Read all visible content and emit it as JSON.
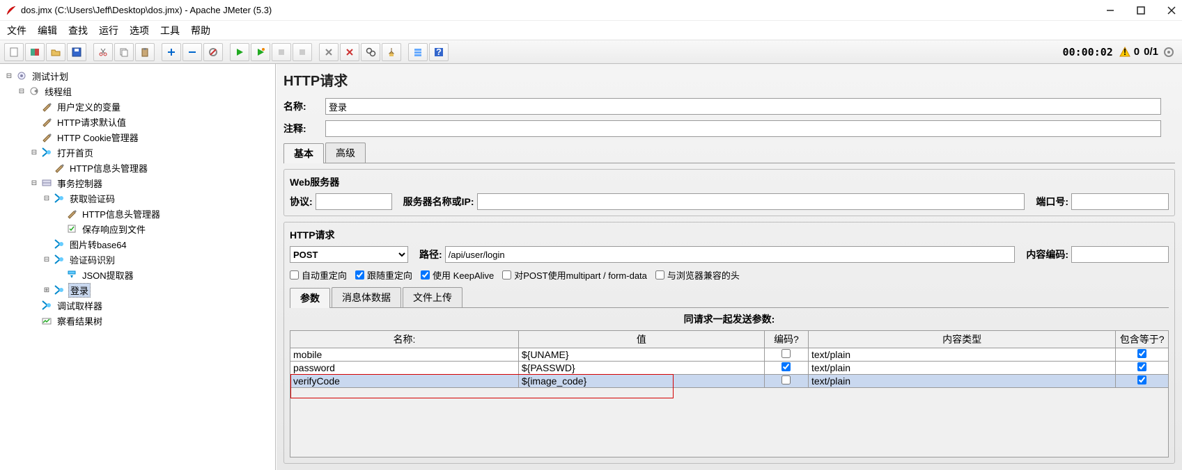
{
  "window": {
    "title": "dos.jmx (C:\\Users\\Jeff\\Desktop\\dos.jmx) - Apache JMeter (5.3)"
  },
  "menus": [
    "文件",
    "编辑",
    "查找",
    "运行",
    "选项",
    "工具",
    "帮助"
  ],
  "status": {
    "elapsed": "00:00:02",
    "warn_count": "0",
    "thread_counts": "0/1"
  },
  "tree": {
    "root": {
      "label": "测试计划"
    },
    "thread_group": {
      "label": "线程组"
    },
    "items": {
      "user_vars": "用户定义的变量",
      "http_defaults": "HTTP请求默认值",
      "cookie_mgr": "HTTP Cookie管理器",
      "open_home": "打开首页",
      "open_home_header": "HTTP信息头管理器",
      "txn_ctrl": "事务控制器",
      "get_captcha": "获取验证码",
      "get_captcha_header": "HTTP信息头管理器",
      "save_resp_file": "保存响应到文件",
      "img_base64": "图片转base64",
      "captcha_ocr": "验证码识别",
      "json_extractor": "JSON提取器",
      "login": "登录",
      "debug_sampler": "调试取样器",
      "view_results": "察看结果树"
    }
  },
  "main": {
    "title": "HTTP请求",
    "name_label": "名称:",
    "name_value": "登录",
    "comment_label": "注释:",
    "comment_value": "",
    "tabs": {
      "basic": "基本",
      "advanced": "高级"
    },
    "web_server": {
      "title": "Web服务器",
      "protocol_label": "协议:",
      "protocol_value": "",
      "server_label": "服务器名称或IP:",
      "server_value": "",
      "port_label": "端口号:",
      "port_value": ""
    },
    "http_req": {
      "title": "HTTP请求",
      "method": "POST",
      "path_label": "路径:",
      "path_value": "/api/user/login",
      "encoding_label": "内容编码:",
      "encoding_value": ""
    },
    "checks": {
      "auto_redirect": "自动重定向",
      "follow_redirect": "跟随重定向",
      "keepalive": "使用 KeepAlive",
      "multipart": "对POST使用multipart / form-data",
      "browser_headers": "与浏览器兼容的头"
    },
    "subtabs": {
      "params": "参数",
      "body": "消息体数据",
      "files": "文件上传"
    },
    "params_title": "同请求一起发送参数:",
    "table": {
      "headers": {
        "name": "名称:",
        "value": "值",
        "encode": "编码?",
        "ctype": "内容类型",
        "include_eq": "包含等于?"
      },
      "rows": [
        {
          "name": "mobile",
          "value": "${UNAME}",
          "encode": false,
          "ctype": "text/plain",
          "eq": true
        },
        {
          "name": "password",
          "value": "${PASSWD}",
          "encode": true,
          "ctype": "text/plain",
          "eq": true
        },
        {
          "name": "verifyCode",
          "value": "${image_code}",
          "encode": false,
          "ctype": "text/plain",
          "eq": true
        }
      ]
    }
  }
}
